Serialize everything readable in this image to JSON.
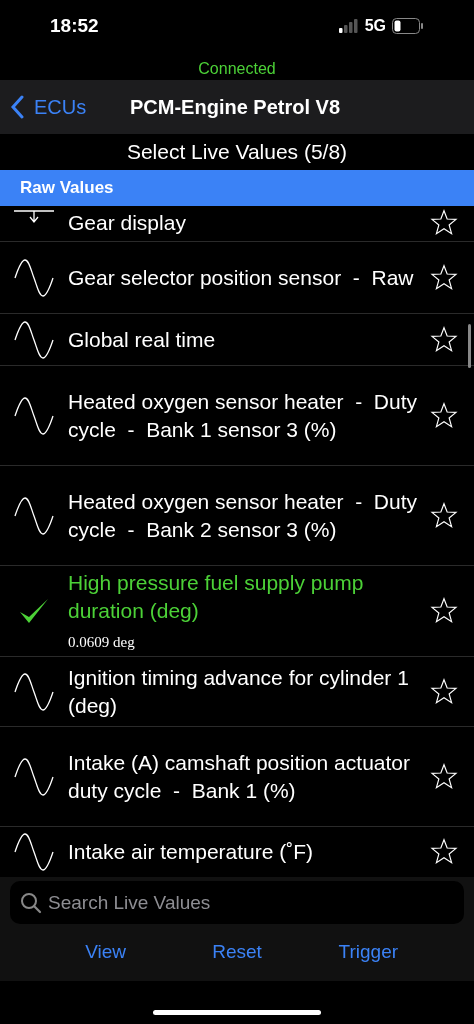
{
  "status_bar": {
    "time": "18:52",
    "network": "5G"
  },
  "connection": {
    "label": "Connected"
  },
  "nav": {
    "back": "ECUs",
    "title": "PCM-Engine Petrol V8"
  },
  "subtitle": "Select Live Values (5/8)",
  "section": "Raw Values",
  "items": [
    {
      "kind": "gear",
      "label": "Gear display",
      "selected": false,
      "starred": false
    },
    {
      "kind": "sine",
      "label": "Gear selector position sensor  -  Raw",
      "selected": false,
      "starred": false
    },
    {
      "kind": "sine",
      "label": "Global real time",
      "selected": false,
      "starred": false
    },
    {
      "kind": "sine",
      "label": "Heated oxygen sensor heater  -  Duty cycle  -  Bank 1 sensor 3 (%)",
      "selected": false,
      "starred": false
    },
    {
      "kind": "sine",
      "label": "Heated oxygen sensor heater  -  Duty cycle  -  Bank 2 sensor 3 (%)",
      "selected": false,
      "starred": false
    },
    {
      "label": "High pressure fuel supply pump duration (deg)",
      "selected": true,
      "value": "0.0609 deg",
      "starred": false
    },
    {
      "kind": "sine",
      "label": "Ignition timing advance for cylinder 1 (deg)",
      "selected": false,
      "starred": false
    },
    {
      "kind": "sine",
      "label": "Intake (A) camshaft position actuator duty cycle  -  Bank 1 (%)",
      "selected": false,
      "starred": false
    },
    {
      "kind": "sine",
      "label": "Intake air temperature (˚F)",
      "selected": false,
      "starred": false
    }
  ],
  "search": {
    "placeholder": "Search Live Values"
  },
  "toolbar": [
    "View",
    "Reset",
    "Trigger"
  ]
}
